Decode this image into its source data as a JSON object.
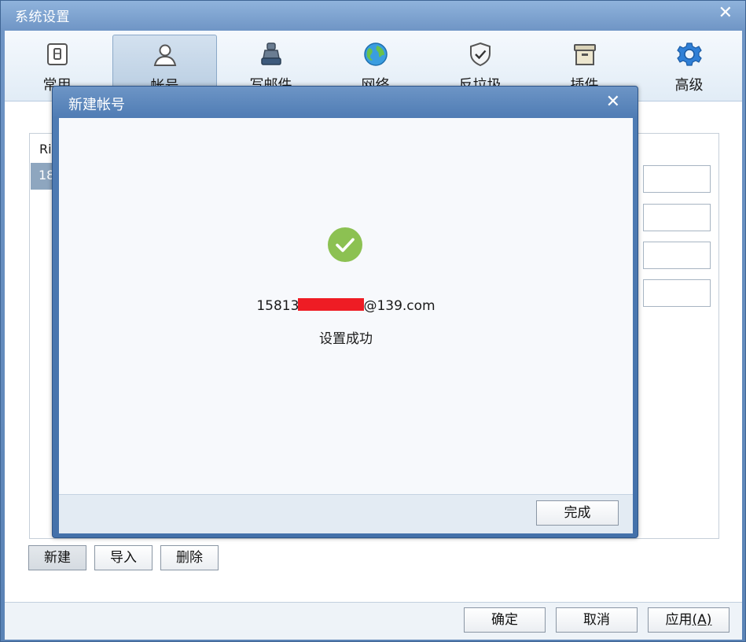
{
  "window": {
    "title": "系统设置",
    "close_glyph": "✕"
  },
  "toolbar": {
    "items": [
      {
        "label": "常用",
        "icon": "general-icon"
      },
      {
        "label": "帐号",
        "icon": "account-icon",
        "active": true
      },
      {
        "label": "写邮件",
        "icon": "compose-icon"
      },
      {
        "label": "网络",
        "icon": "network-globe-icon"
      },
      {
        "label": "反垃圾",
        "icon": "antispam-shield-icon"
      },
      {
        "label": "插件",
        "icon": "plugin-box-icon"
      },
      {
        "label": "高级",
        "icon": "advanced-gear-icon"
      }
    ]
  },
  "account_list": {
    "header": "Ri",
    "row": "18"
  },
  "account_buttons": {
    "new": "新建",
    "import": "导入",
    "delete": "删除"
  },
  "footer": {
    "ok": "确定",
    "cancel": "取消",
    "apply": "应用",
    "apply_hotkey": "(A)"
  },
  "modal": {
    "title": "新建帐号",
    "close_glyph": "✕",
    "email_prefix": "15813",
    "email_suffix": "@139.com",
    "status": "设置成功",
    "finish": "完成"
  },
  "colors": {
    "titlebar": "#6f95c5",
    "success": "#8cc152",
    "redaction": "#ee1c24"
  }
}
